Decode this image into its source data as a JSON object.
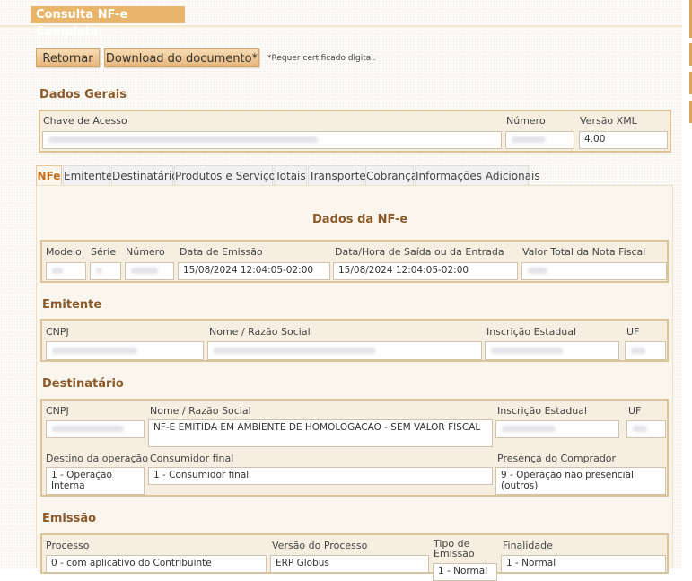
{
  "page": {
    "title": "Consulta NF-e Completa"
  },
  "toolbar": {
    "back_label": "Retornar",
    "download_label": "Download do documento*",
    "note": "*Requer certificado digital."
  },
  "general": {
    "heading": "Dados Gerais",
    "access_key_label": "Chave de Acesso",
    "number_label": "Número",
    "xml_version_label": "Versão XML",
    "xml_version_value": "4.00"
  },
  "tabs": [
    "NFe",
    "Emitente",
    "Destinatário",
    "Produtos e Serviços",
    "Totais",
    "Transporte",
    "Cobrança",
    "Informações Adicionais"
  ],
  "nfe": {
    "heading": "Dados da NF-e",
    "model_label": "Modelo",
    "series_label": "Série",
    "number_label": "Número",
    "issue_date_label": "Data de Emissão",
    "issue_date_value": "15/08/2024 12:04:05-02:00",
    "exit_date_label": "Data/Hora de Saída ou da Entrada",
    "exit_date_value": "15/08/2024 12:04:05-02:00",
    "total_label": "Valor Total da Nota Fiscal"
  },
  "issuer": {
    "heading": "Emitente",
    "cnpj_label": "CNPJ",
    "name_label": "Nome / Razão Social",
    "ie_label": "Inscrição Estadual",
    "uf_label": "UF"
  },
  "recipient": {
    "heading": "Destinatário",
    "cnpj_label": "CNPJ",
    "name_label": "Nome / Razão Social",
    "name_value": "NF-E EMITIDA EM AMBIENTE DE HOMOLOGACAO - SEM VALOR FISCAL",
    "ie_label": "Inscrição Estadual",
    "uf_label": "UF",
    "destination_label": "Destino da operação",
    "destination_value": "1 - Operação Interna",
    "final_consumer_label": "Consumidor final",
    "final_consumer_value": "1 - Consumidor final",
    "presence_label": "Presença do Comprador",
    "presence_value": "9 - Operação não presencial (outros)"
  },
  "emission": {
    "heading": "Emissão",
    "process_label": "Processo",
    "process_value": "0 - com aplicativo do Contribuinte",
    "process_version_label": "Versão do Processo",
    "process_version_value": "ERP Globus",
    "emission_type_label": "Tipo de Emissão",
    "emission_type_value": "1 - Normal",
    "purpose_label": "Finalidade",
    "purpose_value": "1 - Normal"
  },
  "colors": {
    "accent": "#e9b56a",
    "heading": "#8a5a2b",
    "border": "#ddc395"
  }
}
